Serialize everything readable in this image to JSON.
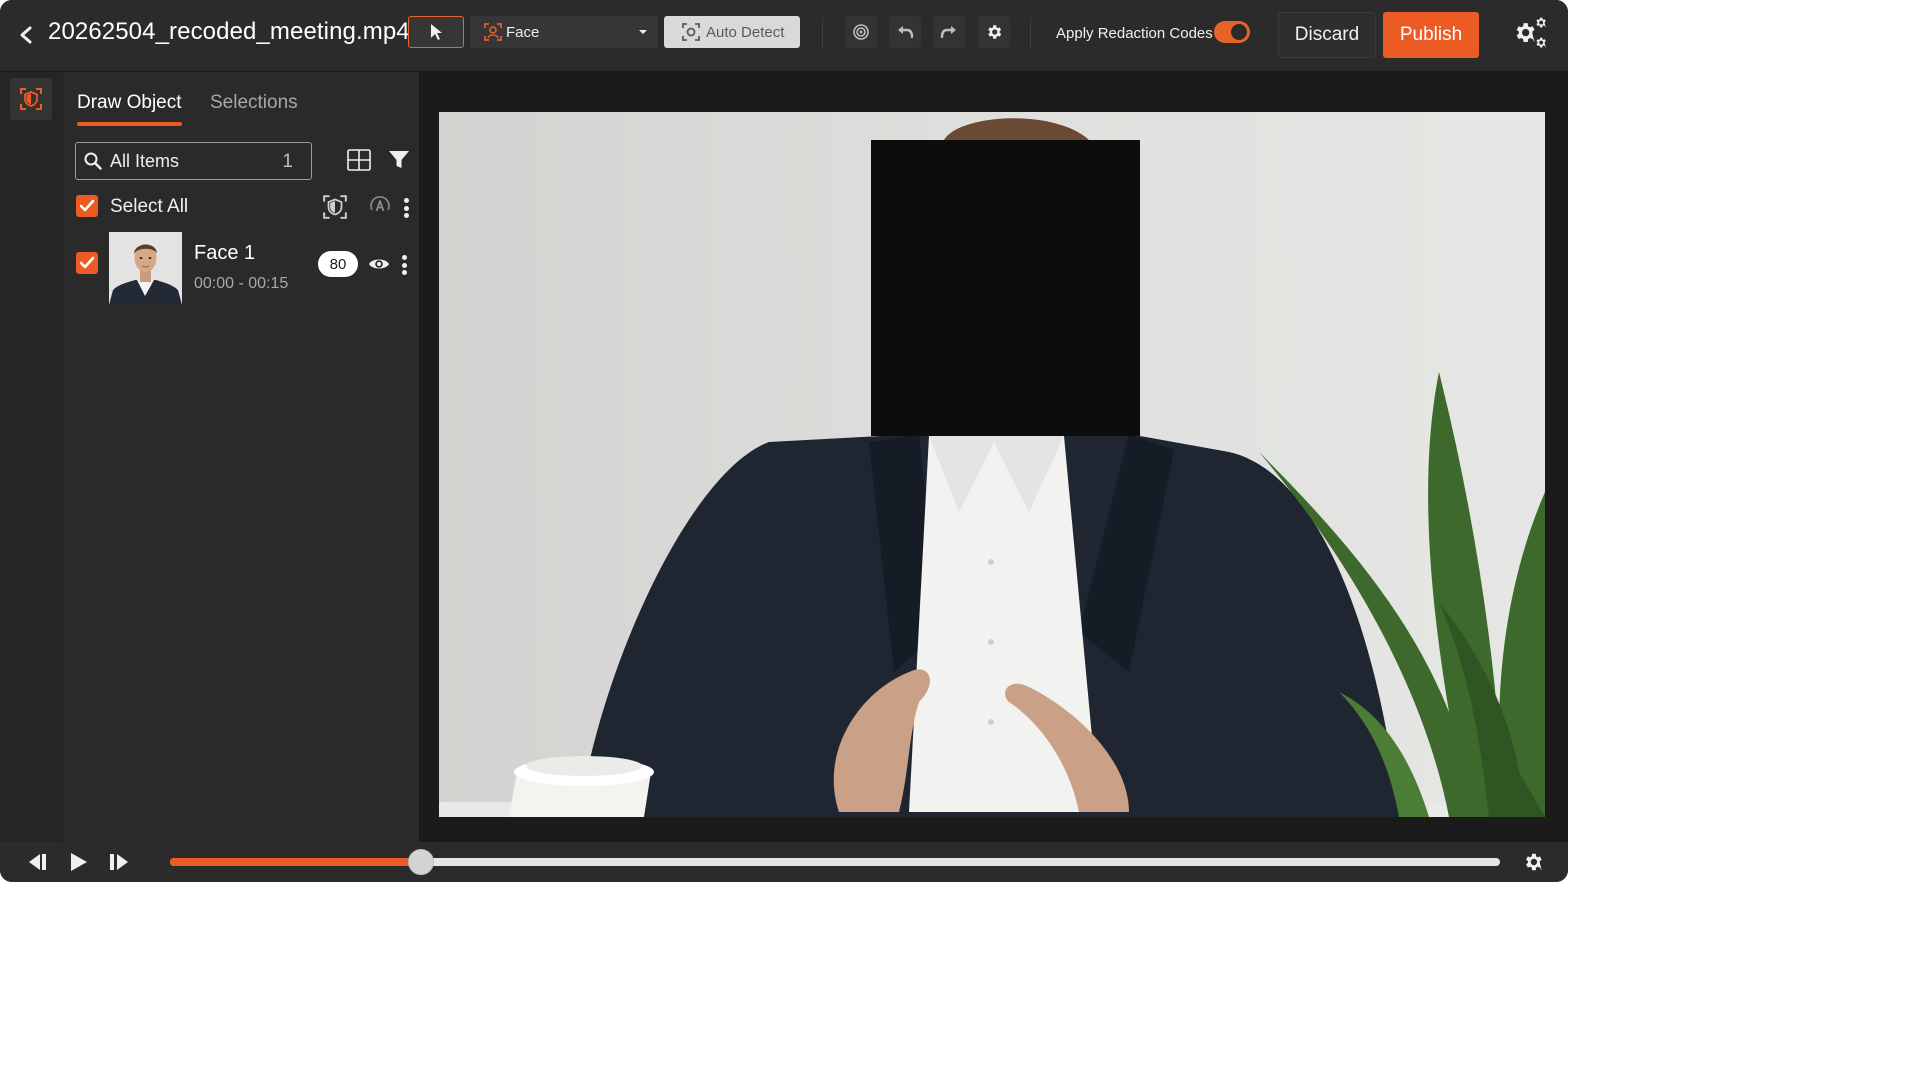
{
  "header": {
    "file_title": "20262504_recoded_meeting.mp4",
    "mode_label": "Face",
    "auto_detect_label": "Auto Detect",
    "apply_redaction_label": "Apply Redaction Codes",
    "apply_redaction_enabled": true,
    "discard_label": "Discard",
    "publish_label": "Publish"
  },
  "panel": {
    "tabs": [
      {
        "label": "Draw Object",
        "active": true
      },
      {
        "label": "Selections",
        "active": false
      }
    ],
    "search": {
      "value": "All Items",
      "count": "1"
    },
    "select_all_label": "Select All",
    "select_all_checked": true,
    "items": [
      {
        "name": "Face 1",
        "time_range": "00:00 - 00:15",
        "score": "80",
        "checked": true,
        "visible": true
      }
    ]
  },
  "playback": {
    "progress": 0.189
  },
  "colors": {
    "accent": "#ec5b24",
    "background": "#1f1f1f",
    "panel": "#2a2a2a",
    "topbar": "#2b2b2b"
  },
  "icons": {
    "back": "chevron-left-icon",
    "select_tool": "cursor-arrow-icon",
    "face_mode": "face-scan-icon",
    "auto_detect": "focus-scan-icon",
    "target": "target-icon",
    "undo": "undo-icon",
    "redo": "redo-icon",
    "settings": "gear-icon",
    "global_settings": "gears-icon",
    "rail_redact": "shield-scan-icon",
    "search": "search-icon",
    "grid": "grid-icon",
    "filter": "filter-icon",
    "eye": "eye-icon",
    "step_back": "step-back-icon",
    "play": "play-icon",
    "step_forward": "step-forward-icon"
  }
}
